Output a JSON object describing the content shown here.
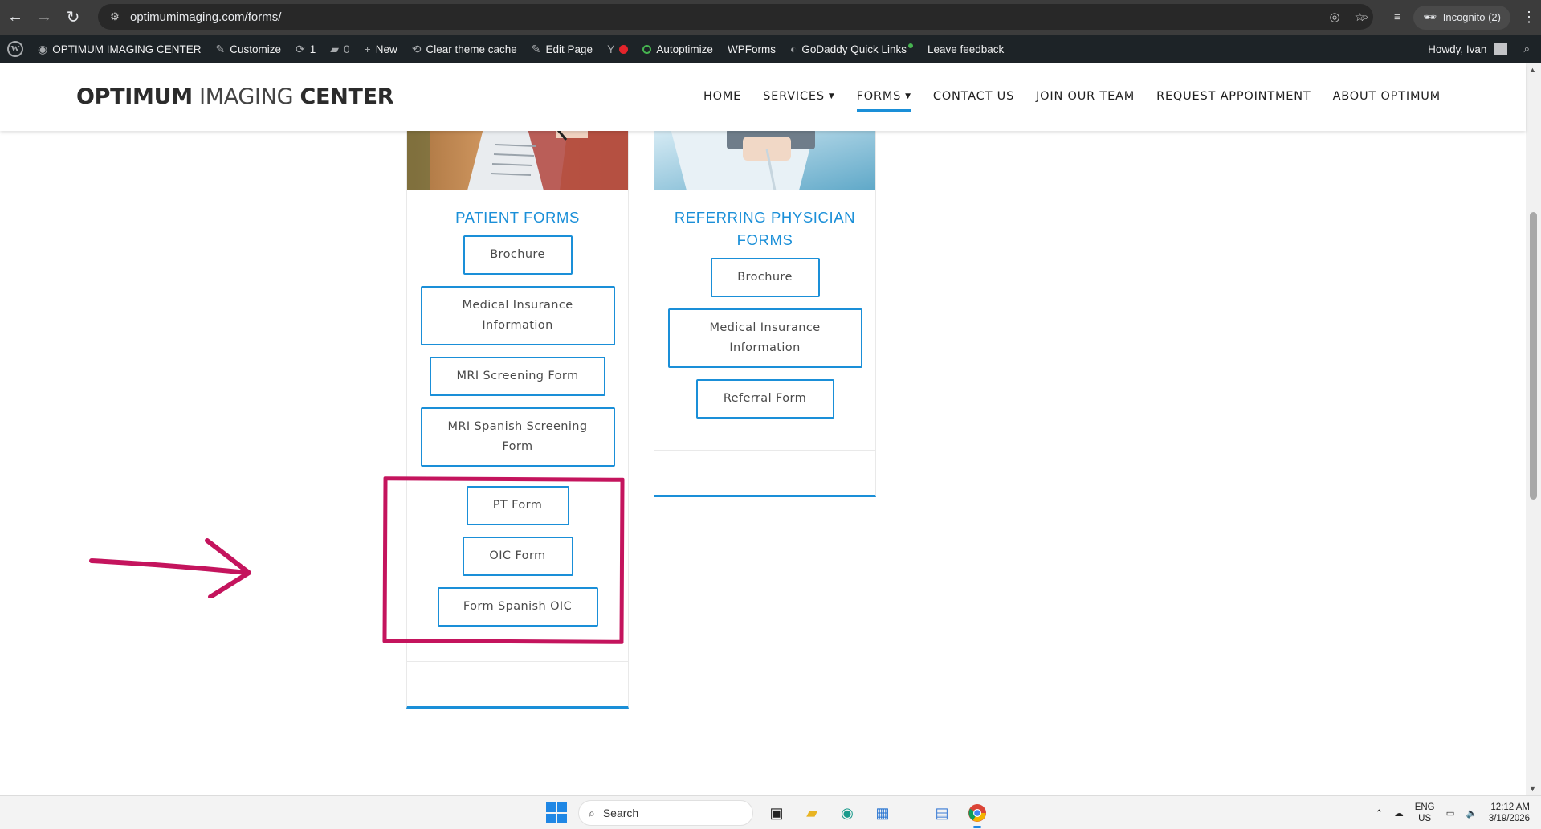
{
  "browser": {
    "url": "optimumimaging.com/forms/",
    "incognito_label": "Incognito (2)"
  },
  "adminbar": {
    "site_name": "OPTIMUM IMAGING CENTER",
    "customize": "Customize",
    "updates_count": "1",
    "comments_count": "0",
    "new": "New",
    "clear_cache": "Clear theme cache",
    "edit_page": "Edit Page",
    "autoptimize": "Autoptimize",
    "wpforms": "WPForms",
    "godaddy": "GoDaddy Quick Links",
    "feedback": "Leave feedback",
    "howdy": "Howdy, Ivan"
  },
  "header": {
    "logo_part1": "OPTIMUM",
    "logo_part2": "IMAGING",
    "logo_part3": "CENTER",
    "nav": {
      "home": "HOME",
      "services": "SERVICES",
      "forms": "FORMS",
      "contact": "CONTACT US",
      "join": "JOIN OUR TEAM",
      "request": "REQUEST APPOINTMENT",
      "about": "ABOUT OPTIMUM"
    }
  },
  "patient_card": {
    "title": "PATIENT FORMS",
    "buttons": [
      "Brochure",
      "Medical Insurance Information",
      "MRI Screening Form",
      "MRI Spanish Screening Form",
      "PT Form",
      "OIC Form",
      "Form Spanish OIC"
    ]
  },
  "physician_card": {
    "title": "REFERRING PHYSICIAN FORMS",
    "buttons": [
      "Brochure",
      "Medical Insurance Information",
      "Referral Form"
    ]
  },
  "annotation_color": "#c4145d",
  "accent_color": "#1a8fd8",
  "taskbar": {
    "search": "Search",
    "lang1": "ENG",
    "lang2": "US",
    "time": "12:12 AM",
    "date": "3/19/2026"
  }
}
